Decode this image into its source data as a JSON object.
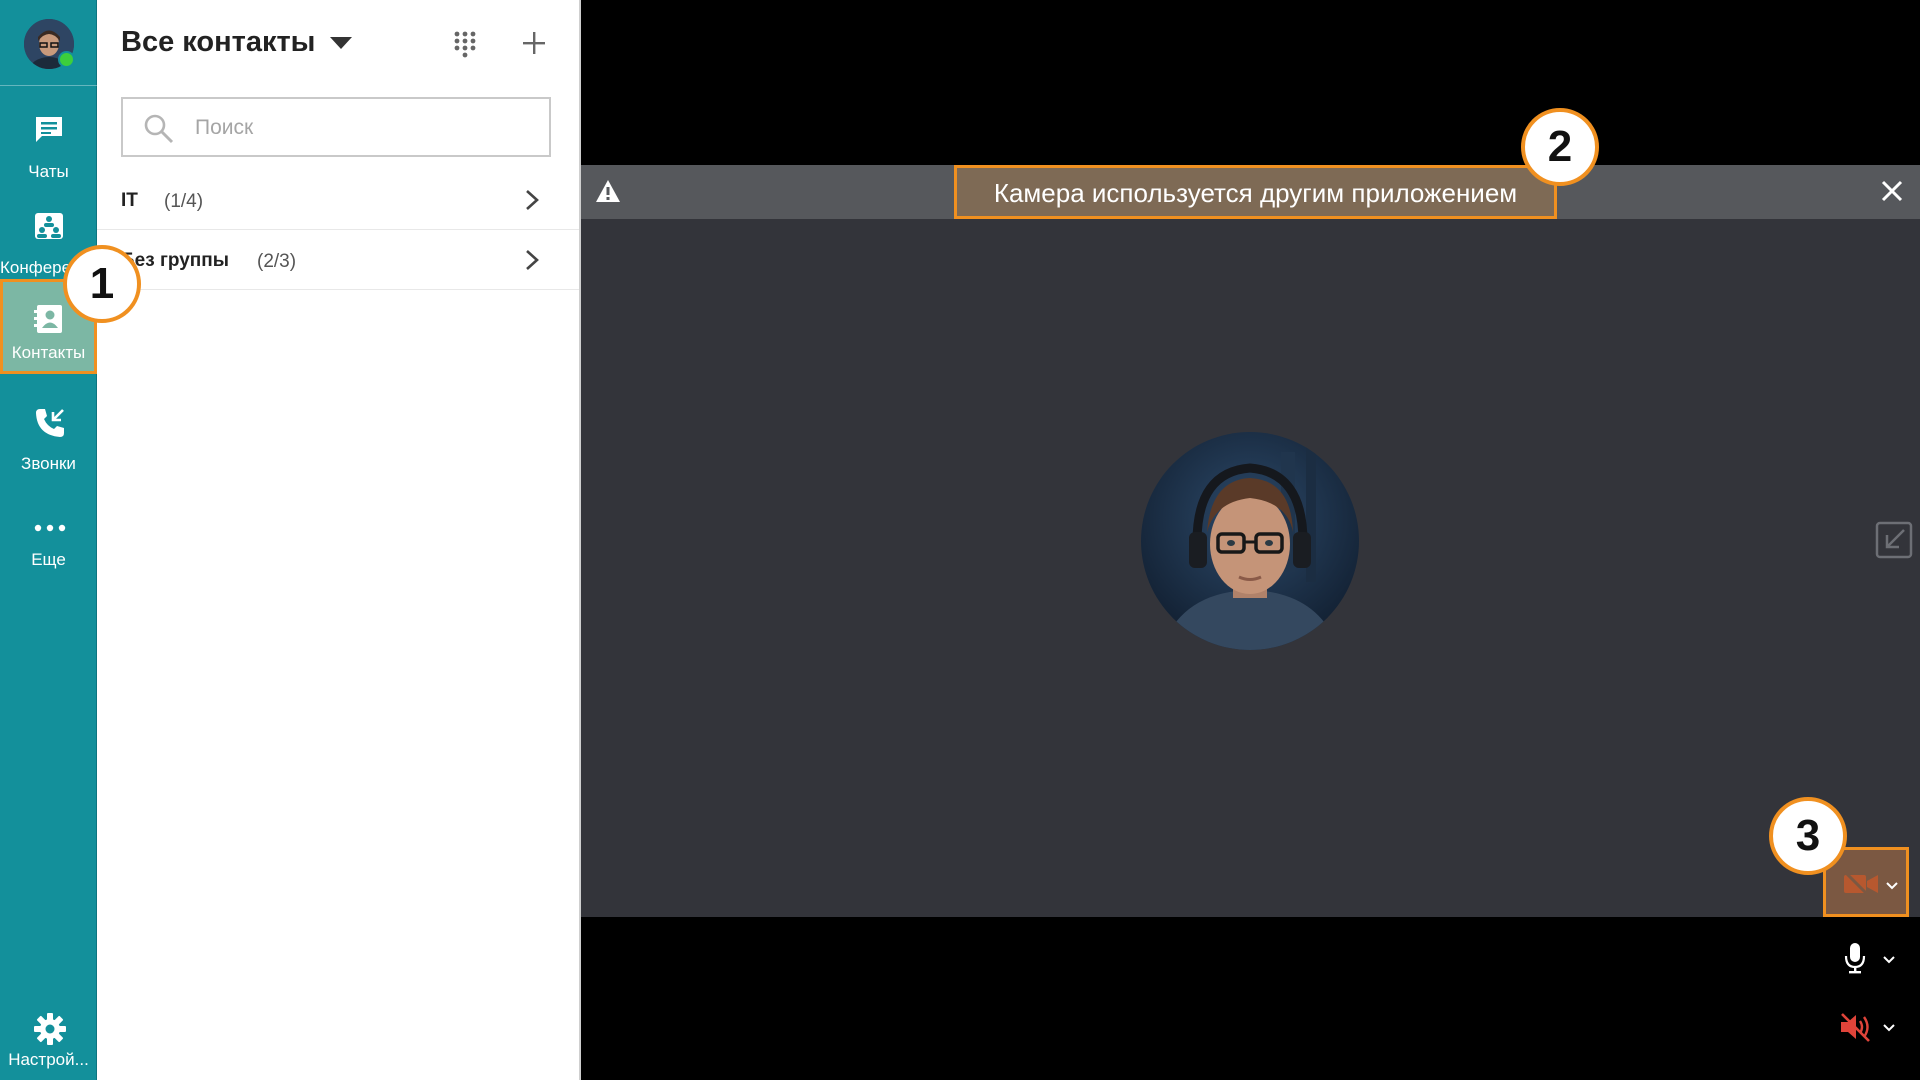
{
  "nav": {
    "items": [
      {
        "key": "chats",
        "label": "Чаты",
        "icon": "chat-icon"
      },
      {
        "key": "conferences",
        "label": "Конференции",
        "icon": "conference-icon"
      },
      {
        "key": "contacts",
        "label": "Контакты",
        "icon": "contacts-icon",
        "active": true
      },
      {
        "key": "calls",
        "label": "Звонки",
        "icon": "calls-icon"
      },
      {
        "key": "more",
        "label": "Еще",
        "icon": "more-icon"
      }
    ],
    "settings_label": "Настрой..."
  },
  "contacts": {
    "title": "Все контакты",
    "search_placeholder": "Поиск",
    "groups": [
      {
        "name": "IT",
        "count": "(1/4)"
      },
      {
        "name": "Без группы",
        "count": "(2/3)"
      }
    ]
  },
  "video": {
    "warning_text": "Камера используется другим приложением"
  },
  "callouts": [
    "1",
    "2",
    "3"
  ],
  "colors": {
    "nav_bg": "#13909b",
    "nav_active": "#7cb7a4",
    "highlight": "#f09020",
    "warning_bar": "#56585c",
    "video_bg": "#33343a",
    "muted_red": "#e0443a"
  }
}
